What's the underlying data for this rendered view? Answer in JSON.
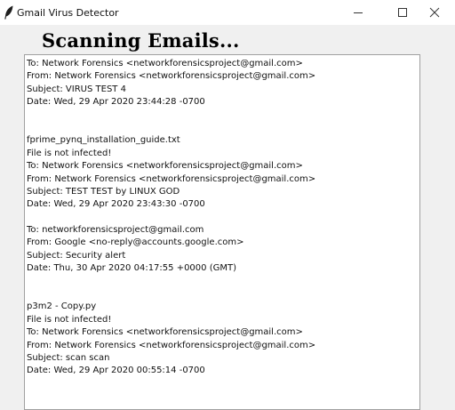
{
  "window": {
    "title": "Gmail Virus Detector",
    "icons": {
      "app": "feather-icon",
      "minimize": "minimize-icon",
      "maximize": "maximize-icon",
      "close": "close-icon"
    }
  },
  "heading": "Scanning Emails...",
  "output_lines": [
    "To: Network Forensics <networkforensicsproject@gmail.com>",
    "From: Network Forensics <networkforensicsproject@gmail.com>",
    "Subject: VIRUS TEST 4",
    "Date: Wed, 29 Apr 2020 23:44:28 -0700",
    "",
    "",
    "fprime_pynq_installation_guide.txt",
    "File is not infected!",
    "To: Network Forensics <networkforensicsproject@gmail.com>",
    "From: Network Forensics <networkforensicsproject@gmail.com>",
    "Subject: TEST TEST by LINUX GOD",
    "Date: Wed, 29 Apr 2020 23:43:30 -0700",
    "",
    "To: networkforensicsproject@gmail.com",
    "From: Google <no-reply@accounts.google.com>",
    "Subject: Security alert",
    "Date: Thu, 30 Apr 2020 04:17:55 +0000 (GMT)",
    "",
    "",
    "p3m2 - Copy.py",
    "File is not infected!",
    "To: Network Forensics <networkforensicsproject@gmail.com>",
    "From: Network Forensics <networkforensicsproject@gmail.com>",
    "Subject: scan scan",
    "Date: Wed, 29 Apr 2020 00:55:14 -0700"
  ]
}
